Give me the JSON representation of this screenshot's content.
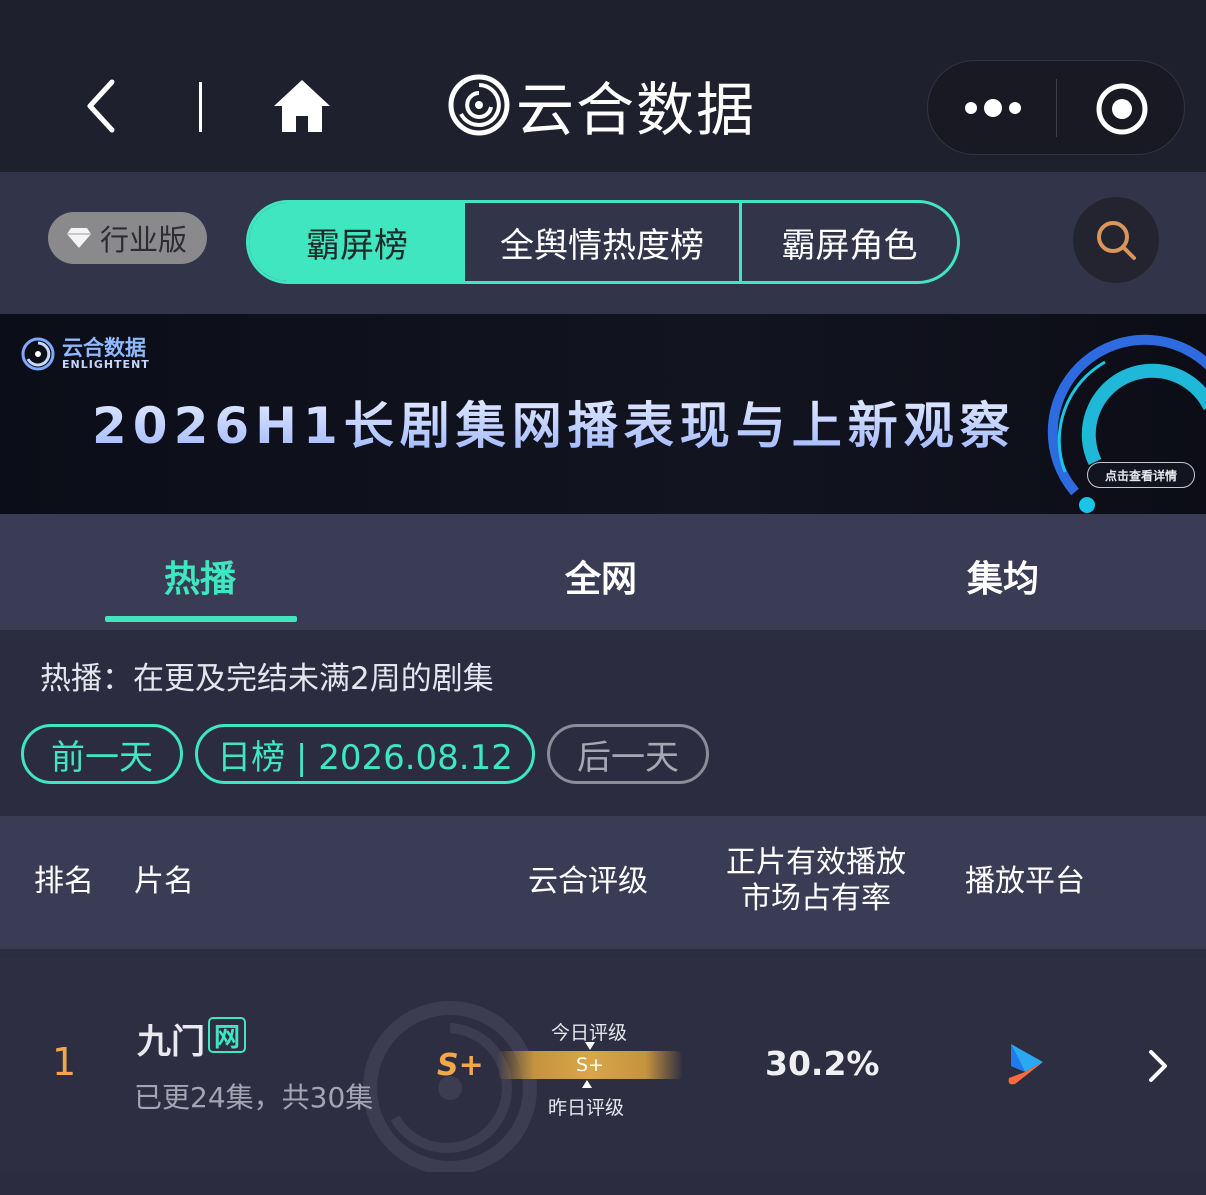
{
  "app": {
    "title": "云合数据"
  },
  "nav": {
    "industry_label": "行业版",
    "segments": [
      "霸屏榜",
      "全舆情热度榜",
      "霸屏角色"
    ],
    "active_segment": 0
  },
  "banner": {
    "logo_cn": "云合数据",
    "logo_en": "ENLIGHTENT",
    "title": "2026H1长剧集网播表现与上新观察",
    "detail_button": "点击查看详情"
  },
  "tabs": {
    "items": [
      "热播",
      "全网",
      "集均"
    ],
    "active": 0
  },
  "description": "热播：在更及完结未满2周的剧集",
  "date_nav": {
    "prev": "前一天",
    "current": "日榜 | 2026.08.12",
    "next": "后一天"
  },
  "table": {
    "headers": {
      "rank": "排名",
      "name": "片名",
      "rating": "云合评级",
      "share_line1": "正片有效播放",
      "share_line2": "市场占有率",
      "platform": "播放平台"
    },
    "rows": [
      {
        "rank": "1",
        "name": "九门",
        "badge": "网",
        "episodes": "已更24集，共30集",
        "grade": "S+",
        "today_label": "今日评级",
        "bar_grade": "S+",
        "yesterday_label": "昨日评级",
        "share": "30.2%",
        "platform_icon": "youku-play-icon"
      }
    ]
  },
  "colors": {
    "accent": "#40e6c0",
    "grade": "#f2a84a",
    "background": "#2b2c3f",
    "header_bg": "#3a3b54"
  }
}
